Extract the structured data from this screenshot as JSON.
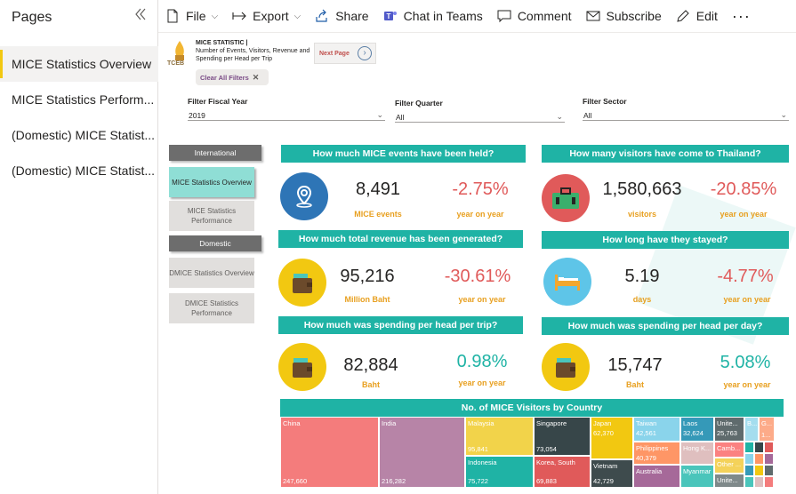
{
  "pages_pane": {
    "title": "Pages",
    "items": [
      {
        "label": "MICE Statistics Overview",
        "active": true
      },
      {
        "label": "MICE Statistics Perform...",
        "active": false
      },
      {
        "label": "(Domestic) MICE Statist...",
        "active": false
      },
      {
        "label": "(Domestic) MICE Statist...",
        "active": false
      }
    ]
  },
  "toolbar": {
    "file": "File",
    "export": "Export",
    "share": "Share",
    "chat": "Chat in Teams",
    "comment": "Comment",
    "subscribe": "Subscribe",
    "edit": "Edit",
    "more": "···"
  },
  "report": {
    "logo_text": "TCEB",
    "header_title": "MICE STATISTIC |",
    "header_subtitle": "Number of Events, Visitors, Revenue and Spending per Head per Trip",
    "next_page": "Next Page",
    "clear_filters": "Clear All Filters",
    "filters": [
      {
        "label": "Filter Fiscal Year",
        "value": "2019"
      },
      {
        "label": "Filter Quarter",
        "value": "All"
      },
      {
        "label": "Filter Sector",
        "value": "All"
      }
    ],
    "nav": {
      "international": "International",
      "domestic": "Domestic",
      "btn_overview": "MICE Statistics Overview",
      "btn_performance": "MICE Statistics Performance",
      "btn_d_overview": "DMICE Statistics Overview",
      "btn_d_performance": "DMICE Statistics Performance"
    },
    "kpis": {
      "events": {
        "question": "How much MICE events have been held?",
        "value": "8,491",
        "unit": "MICE events",
        "pct": "-2.75%",
        "sub": "year on year"
      },
      "visitors": {
        "question": "How many visitors have come to Thailand?",
        "value": "1,580,663",
        "unit": "visitors",
        "pct": "-20.85%",
        "sub": "year on year"
      },
      "revenue": {
        "question": "How much total revenue has been generated?",
        "value": "95,216",
        "unit": "Million Baht",
        "pct": "-30.61%",
        "sub": "year on year"
      },
      "stay": {
        "question": "How long have they stayed?",
        "value": "5.19",
        "unit": "days",
        "pct": "-4.77%",
        "sub": "year on year"
      },
      "trip": {
        "question": "How much was spending per head per trip?",
        "value": "82,884",
        "unit": "Baht",
        "pct": "0.98%",
        "sub": "year on year"
      },
      "day": {
        "question": "How much was spending per head per day?",
        "value": "15,747",
        "unit": "Baht",
        "pct": "5.08%",
        "sub": "year on year"
      }
    },
    "treemap_title": "No. of MICE Visitors by Country",
    "treemap": [
      {
        "name": "China",
        "value": "247,660",
        "color": "#f47c7c"
      },
      {
        "name": "India",
        "value": "216,282",
        "color": "#b784a7"
      },
      {
        "name": "Malaysia",
        "value": "95,841",
        "color": "#f2d34a"
      },
      {
        "name": "Indonesia",
        "value": "75,722",
        "color": "#1fb3a5"
      },
      {
        "name": "Singapore",
        "value": "73,054",
        "color": "#374649"
      },
      {
        "name": "Korea, South",
        "value": "69,883",
        "color": "#e05a5a"
      },
      {
        "name": "Japan",
        "value": "62,370",
        "color": "#f2c811"
      },
      {
        "name": "Vietnam",
        "value": "42,729",
        "color": "#3e4b4d"
      },
      {
        "name": "Taiwan",
        "value": "42,561",
        "color": "#8ad4eb"
      },
      {
        "name": "Philippines",
        "value": "40,379",
        "color": "#fe9666"
      },
      {
        "name": "Australia",
        "value": "",
        "color": "#a66999"
      },
      {
        "name": "Laos",
        "value": "32,624",
        "color": "#3599b8"
      },
      {
        "name": "Hong K...",
        "value": "",
        "color": "#dfbfbf"
      },
      {
        "name": "Myanmar",
        "value": "",
        "color": "#4ac5bb"
      },
      {
        "name": "Unite...",
        "value": "25,763",
        "color": "#5f6b6d"
      },
      {
        "name": "Camb...",
        "value": "",
        "color": "#fb8281"
      },
      {
        "name": "Other ...",
        "value": "",
        "color": "#f4d25a"
      },
      {
        "name": "Unite...",
        "value": "",
        "color": "#7f898a"
      },
      {
        "name": "B...",
        "value": "",
        "color": "#a4ddee"
      },
      {
        "name": "G...",
        "value": "1...",
        "color": "#fdab89"
      }
    ]
  }
}
